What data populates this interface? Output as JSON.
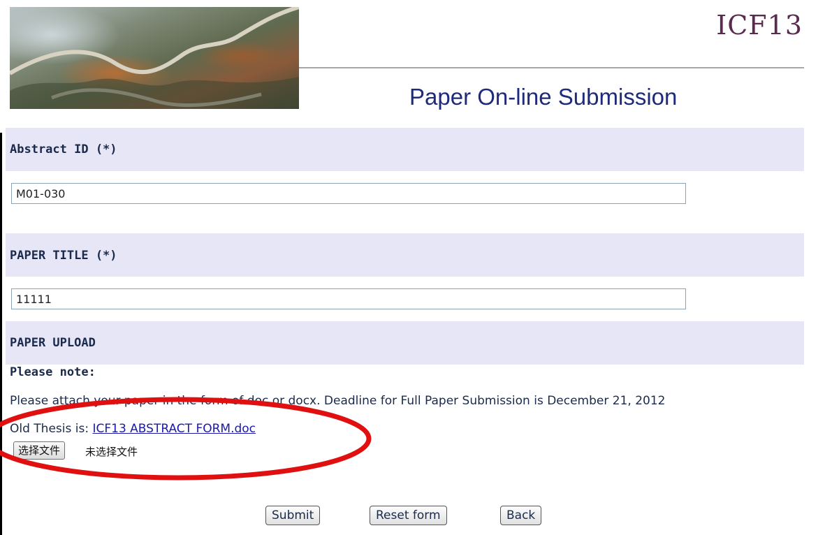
{
  "header": {
    "brand": "ICF13",
    "page_title": "Paper On-line Submission"
  },
  "abstract": {
    "label": "Abstract ID (*)",
    "value": "M01-030"
  },
  "title_section": {
    "label": "PAPER TITLE (*)",
    "value": "11111"
  },
  "upload": {
    "label": "PAPER UPLOAD",
    "note_label": "Please note:",
    "note_text": "Please attach your paper in the form of doc or docx. Deadline for Full Paper Submission is December 21, 2012",
    "old_prefix": "Old Thesis is: ",
    "old_link": "ICF13 ABSTRACT FORM.doc",
    "choose_file_label": "选择文件",
    "file_status": "未选择文件"
  },
  "actions": {
    "submit": "Submit",
    "reset": "Reset form",
    "back": "Back"
  },
  "colors": {
    "band": "#e6e6f7",
    "title": "#1e2a7a",
    "brand": "#5a2a4f",
    "annotation": "#e01010"
  }
}
